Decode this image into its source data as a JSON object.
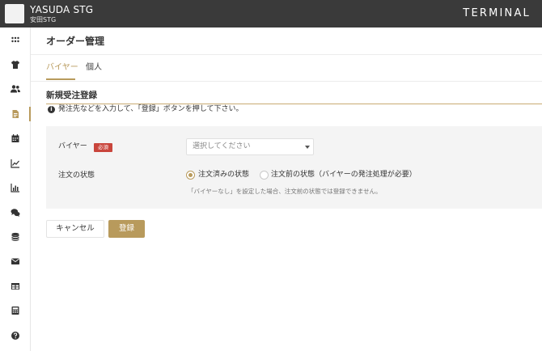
{
  "header": {
    "company_en": "YASUDA STG",
    "company_jp": "安田STG",
    "brand": "TERMINAL"
  },
  "sidebar": {
    "items": [
      {
        "icon": "grid-icon"
      },
      {
        "icon": "tshirt-icon"
      },
      {
        "icon": "users-icon"
      },
      {
        "icon": "document-icon",
        "active": true
      },
      {
        "icon": "calendar-icon"
      },
      {
        "icon": "trend-chart-icon"
      },
      {
        "icon": "bar-chart-icon"
      },
      {
        "icon": "chat-icon"
      },
      {
        "icon": "database-icon"
      },
      {
        "icon": "mail-icon"
      },
      {
        "icon": "table-icon"
      },
      {
        "icon": "calculator-icon"
      },
      {
        "icon": "help-icon"
      }
    ]
  },
  "page": {
    "title": "オーダー管理",
    "tabs": [
      {
        "label": "バイヤー",
        "active": true
      },
      {
        "label": "個人",
        "active": false
      }
    ]
  },
  "section": {
    "title": "新規受注登録",
    "info": "発注先などを入力して、「登録」ボタンを押して下さい。"
  },
  "form": {
    "buyer_label": "バイヤー",
    "required_badge": "必須",
    "buyer_select_placeholder": "選択してください",
    "status_label": "注文の状態",
    "status_options": [
      {
        "label": "注文済みの状態",
        "checked": true
      },
      {
        "label": "注文前の状態（バイヤーの発注処理が必要）",
        "checked": false
      }
    ],
    "hint": "「バイヤーなし」を設定した場合、注文前の状態では登録できません。"
  },
  "buttons": {
    "cancel": "キャンセル",
    "submit": "登録"
  },
  "colors": {
    "accent": "#b89a5c",
    "header_bg": "#3a3a3a",
    "required_badge": "#c9453c"
  }
}
